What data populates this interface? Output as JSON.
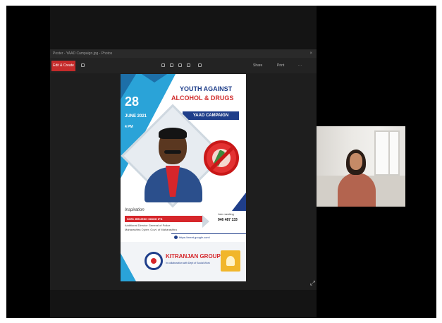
{
  "viewer": {
    "title": "Poster - YAAD Campaign.jpg - Photos",
    "close_glyph": "×",
    "toolbar": {
      "edit_label": "Edit & Create",
      "share_label": "Share",
      "print_label": "Print",
      "more_label": "···"
    },
    "resize_glyph": "⤢"
  },
  "poster": {
    "date": "28",
    "month_year": "JUNE 2021",
    "time": "4 PM",
    "title_line1": "YOUTH AGAINST",
    "title_line2": "ALCOHOL & DRUGS",
    "campaign": "YAAD CAMPAIGN",
    "inspiration_label": "Inspiration",
    "speaker_name": "SHRI. BRIJESH SINGH IPS",
    "speaker_role1": "Additional Director General of Police",
    "speaker_role2": "Maharashtra Cyber, Govt. of Maharashtra",
    "join_label": "Join meeting",
    "meeting_id": "946 487 133",
    "url": "https://meet.google.com/",
    "group_name": "KITRANJAN GROUP",
    "group_subtitle": "In collaboration with Dept of Social Work"
  },
  "colors": {
    "accent_blue": "#2aa3d8",
    "navy": "#1f3e8a",
    "red": "#d6262b",
    "toolbar_red": "#c62b2b"
  }
}
